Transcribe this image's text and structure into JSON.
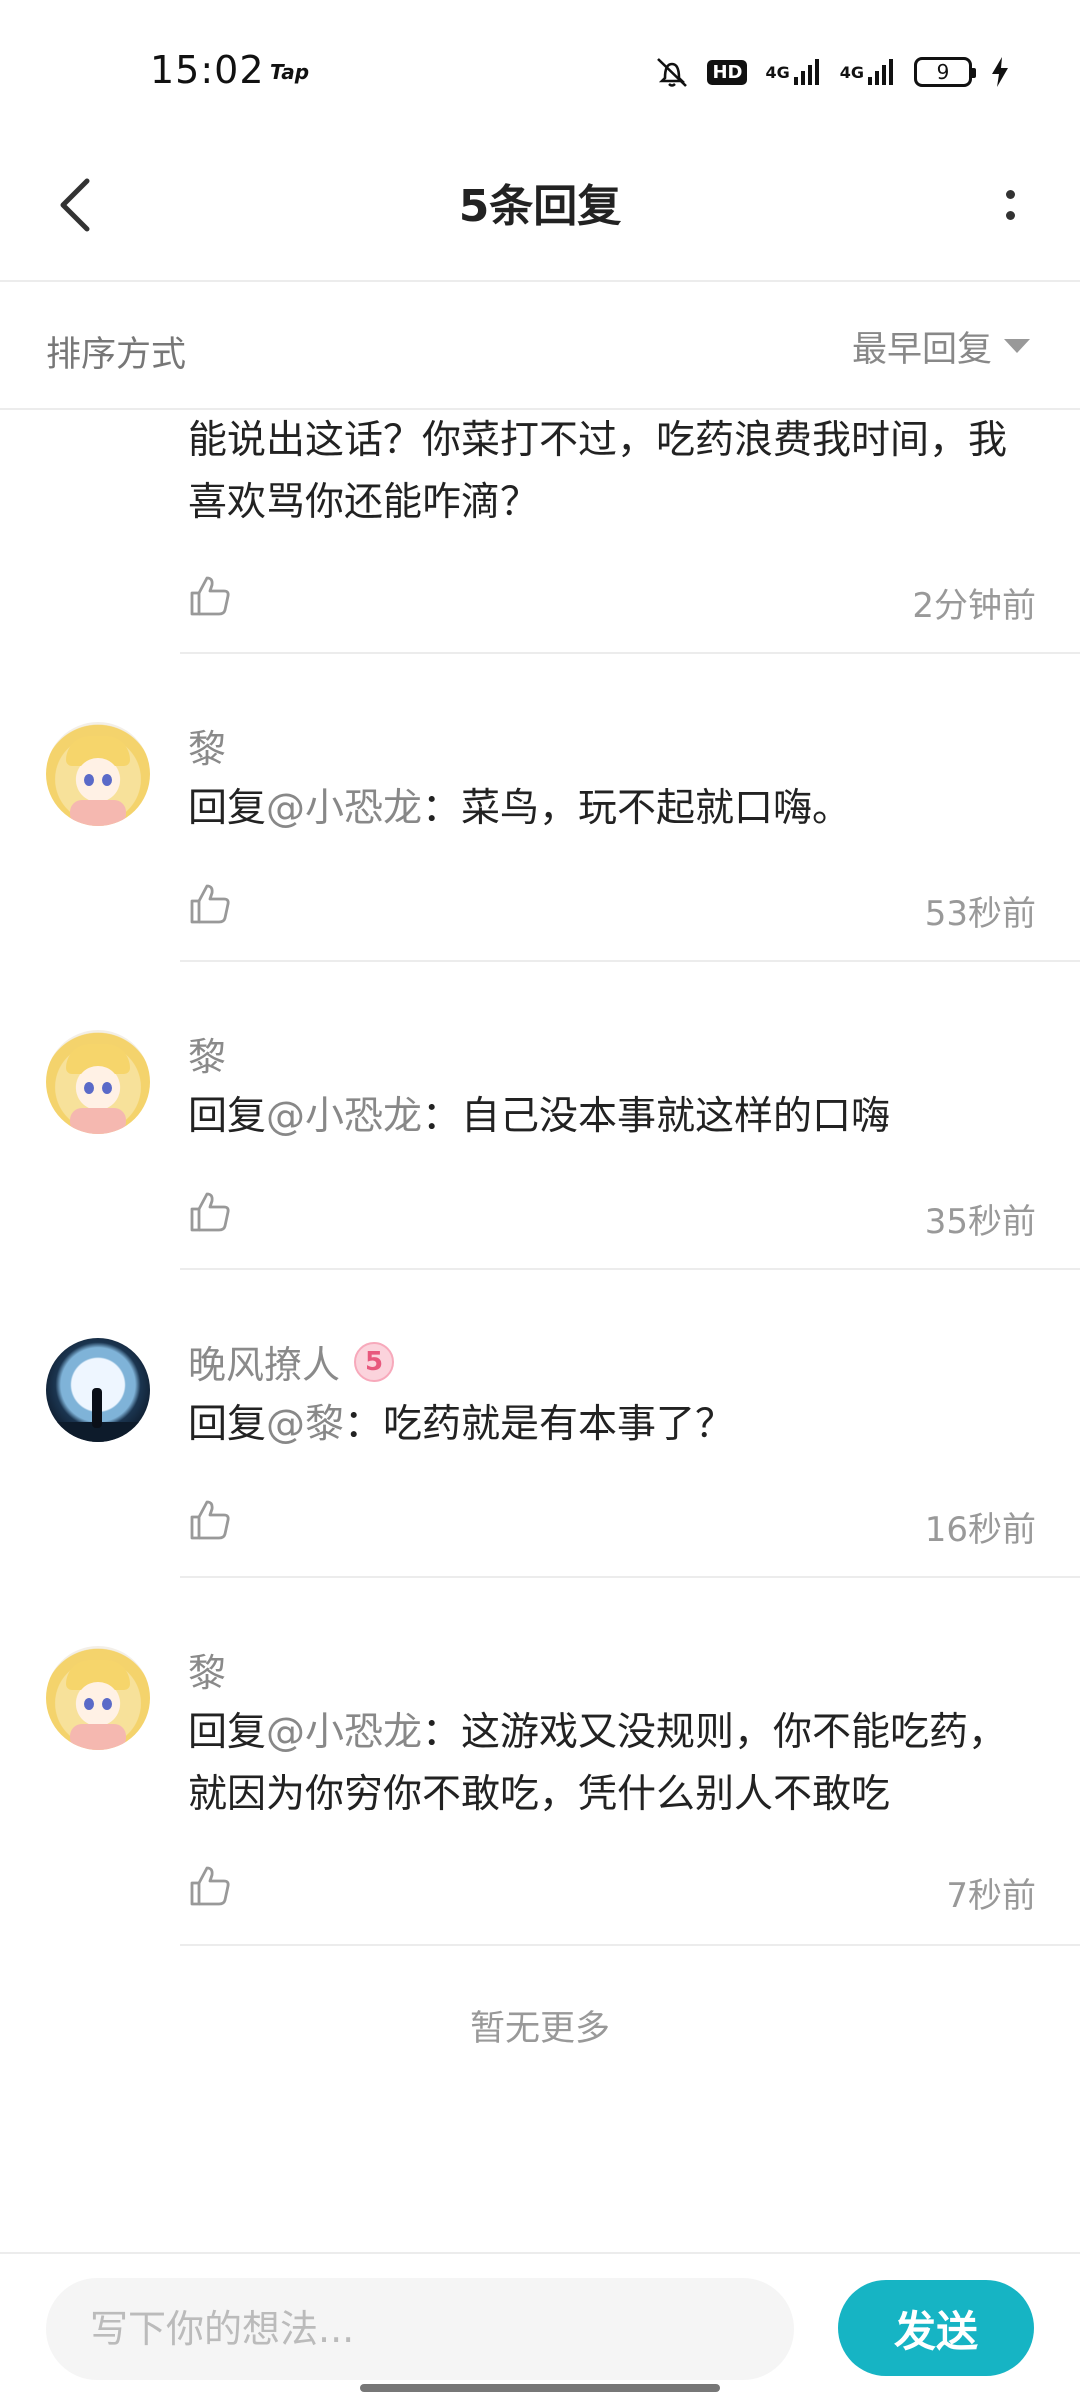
{
  "status_bar": {
    "time": "15:02",
    "app_badge": "Tap",
    "hd_label": "HD",
    "network_1": "4G",
    "network_2": "4G",
    "battery_level": "9"
  },
  "header": {
    "title": "5条回复"
  },
  "sort": {
    "label": "排序方式",
    "value": "最早回复"
  },
  "replies": [
    {
      "username": "",
      "text_before": "能说出这话？你菜打不过，吃药浪费我时间，我喜欢骂你还能咋滴？",
      "mention": "",
      "text_after": "",
      "time": "2分钟前"
    },
    {
      "username": "黎",
      "text_before": "回复",
      "mention": "@小恐龙",
      "text_after": "：菜鸟，玩不起就口嗨。",
      "time": "53秒前"
    },
    {
      "username": "黎",
      "text_before": "回复",
      "mention": "@小恐龙",
      "text_after": "：自己没本事就这样的口嗨",
      "time": "35秒前"
    },
    {
      "username": "晚风撩人",
      "level": "5",
      "text_before": "回复",
      "mention": "@黎",
      "text_after": "：吃药就是有本事了？",
      "time": "16秒前"
    },
    {
      "username": "黎",
      "text_before": "回复",
      "mention": "@小恐龙",
      "text_after": "：这游戏又没规则，你不能吃药，就因为你穷你不敢吃，凭什么别人不敢吃",
      "time": "7秒前"
    }
  ],
  "footer_text": "暂无更多",
  "composer": {
    "placeholder": "写下你的想法...",
    "send_label": "发送"
  },
  "colors": {
    "accent": "#16b4c4",
    "mention": "#888888",
    "badge": "#e8587d"
  },
  "icons": [
    "back-arrow-icon",
    "more-vertical-icon",
    "chevron-down-icon",
    "thumbs-up-icon",
    "mute-icon",
    "charging-icon"
  ]
}
